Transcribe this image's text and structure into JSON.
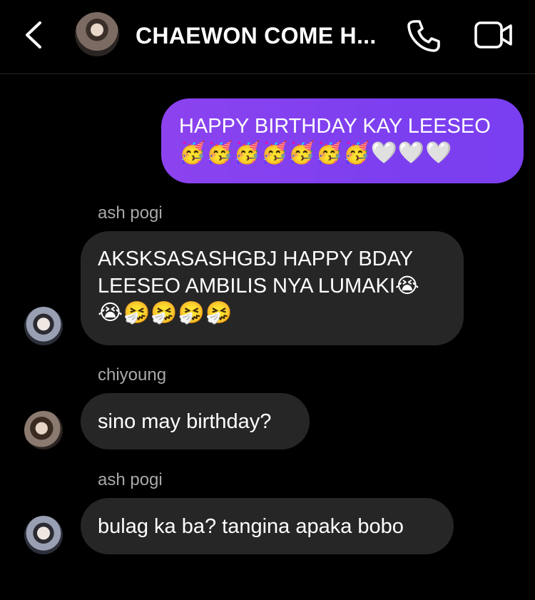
{
  "header": {
    "title": "CHAEWON COME H...",
    "back_icon": "chevron-left-icon",
    "call_icon": "phone-icon",
    "video_icon": "video-camera-icon"
  },
  "messages": [
    {
      "type": "sent",
      "lines": [
        "HAPPY BIRTHDAY KAY LEESEO",
        "🥳🥳🥳🥳🥳🥳🥳🤍🤍🤍"
      ]
    },
    {
      "type": "received",
      "sender": "ash pogi",
      "lines": [
        "AKSKSASASHGBJ HAPPY BDAY",
        "LEESEO AMBILIS NYA LUMAKI😭",
        "😭🤧🤧🤧🤧"
      ]
    },
    {
      "type": "received",
      "sender": "chiyoung",
      "lines": [
        "sino may birthday?"
      ]
    },
    {
      "type": "received",
      "sender": "ash pogi",
      "lines": [
        "bulag ka ba? tangina apaka bobo"
      ]
    }
  ],
  "colors": {
    "background": "#000000",
    "sent_bubble": "#7a3ff0",
    "received_bubble": "#262626",
    "sender_label": "#a8a8a8"
  }
}
